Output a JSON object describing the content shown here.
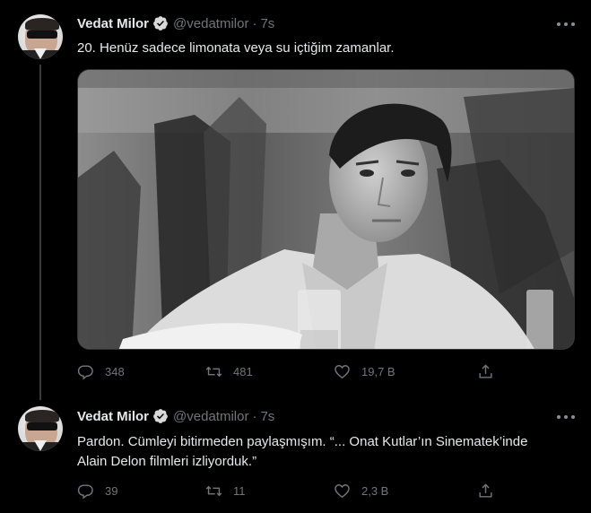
{
  "tweets": [
    {
      "author": {
        "name": "Vedat Milor",
        "handle": "@vedatmilor"
      },
      "separator": "·",
      "time": "7s",
      "text": "20. Henüz sadece limonata veya su içtiğim zamanlar.",
      "stats": {
        "replies": "348",
        "retweets": "481",
        "likes": "19,7 B"
      }
    },
    {
      "author": {
        "name": "Vedat Milor",
        "handle": "@vedatmilor"
      },
      "separator": "·",
      "time": "7s",
      "text_line1": "Pardon. Cümleyi bitirmeden paylaşmışım. “... Onat Kutlar’ın Sinematek’inde",
      "text_line2": "Alain Delon filmleri izliyorduk.”",
      "stats": {
        "replies": "39",
        "retweets": "11",
        "likes": "2,3 B"
      }
    }
  ],
  "colors": {
    "background": "#000000",
    "text": "#e7e9ea",
    "muted": "#71767b",
    "verified": "#1d9bf0"
  },
  "icons": [
    "verified-badge-icon",
    "more-icon",
    "reply-icon",
    "retweet-icon",
    "like-icon",
    "share-icon"
  ]
}
